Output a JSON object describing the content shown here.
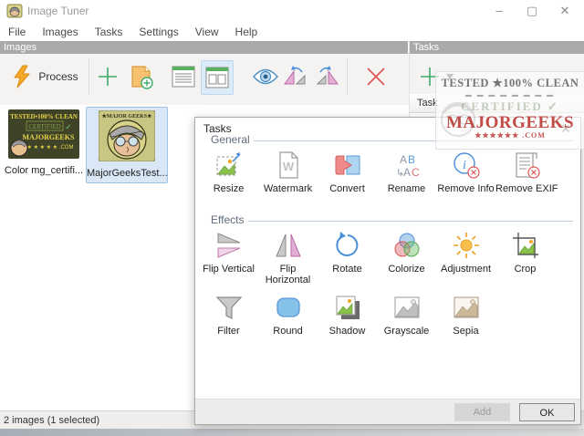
{
  "window": {
    "title": "Image Tuner",
    "controls": {
      "minimize": "–",
      "maximize": "▢",
      "close": "✕"
    }
  },
  "menu": {
    "items": [
      "File",
      "Images",
      "Tasks",
      "Settings",
      "View",
      "Help"
    ]
  },
  "panes": {
    "images_header": "Images",
    "tasks_header": "Tasks",
    "tasks_column_header": "Task"
  },
  "toolbar": {
    "process_label": "Process"
  },
  "thumbnails": [
    {
      "label": "Color mg_certifi...",
      "selected": false
    },
    {
      "label": "MajorGeeksTest...",
      "selected": true
    }
  ],
  "dialog": {
    "title": "Tasks",
    "close": "✕",
    "groups": [
      {
        "label": "General",
        "items": [
          {
            "label": "Resize",
            "icon": "resize-icon"
          },
          {
            "label": "Watermark",
            "icon": "watermark-icon"
          },
          {
            "label": "Convert",
            "icon": "convert-icon"
          },
          {
            "label": "Rename",
            "icon": "rename-icon"
          },
          {
            "label": "Remove Info",
            "icon": "remove-info-icon"
          },
          {
            "label": "Remove EXIF",
            "icon": "remove-exif-icon"
          }
        ]
      },
      {
        "label": "Effects",
        "items": [
          {
            "label": "Flip Vertical",
            "icon": "flip-vertical-icon"
          },
          {
            "label": "Flip Horizontal",
            "icon": "flip-horizontal-icon"
          },
          {
            "label": "Rotate",
            "icon": "rotate-icon"
          },
          {
            "label": "Colorize",
            "icon": "colorize-icon"
          },
          {
            "label": "Adjustment",
            "icon": "adjustment-icon"
          },
          {
            "label": "Crop",
            "icon": "crop-icon"
          },
          {
            "label": "Filter",
            "icon": "filter-icon"
          },
          {
            "label": "Round",
            "icon": "round-icon"
          },
          {
            "label": "Shadow",
            "icon": "shadow-icon"
          },
          {
            "label": "Grayscale",
            "icon": "grayscale-icon"
          },
          {
            "label": "Sepia",
            "icon": "sepia-icon"
          }
        ]
      }
    ],
    "buttons": {
      "add": "Add",
      "ok": "OK"
    }
  },
  "statusbar": {
    "text": "2 images (1 selected)"
  },
  "watermark": {
    "line1": "TESTED ★100% CLEAN",
    "line2": "▬ ▬ ▬ ▬ ▬ ▬ ▬ ▬",
    "line3": "CERTIFIED ✓",
    "line4": "MAJORGEEKS",
    "line5": "★★★★★★  .COM"
  },
  "colors": {
    "accent_green": "#3faa6a",
    "accent_blue": "#4a90d9",
    "accent_red": "#e05555",
    "accent_orange": "#f5a623",
    "panel_header": "#a9a9a9",
    "selection": "#d9e7f6"
  }
}
